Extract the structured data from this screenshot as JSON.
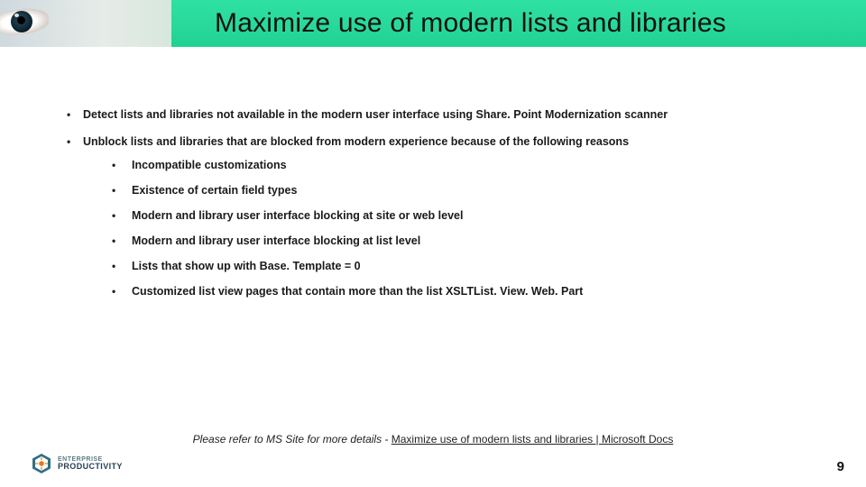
{
  "header": {
    "title": "Maximize use of modern lists and libraries"
  },
  "bullets": [
    {
      "text": "Detect lists and libraries not available in the modern user interface using  Share. Point Modernization scanner"
    },
    {
      "text": "Unblock lists and libraries that are blocked from modern experience because of the following reasons",
      "sub": [
        "Incompatible customizations",
        "Existence of certain field types",
        "Modern and library user interface blocking at site or web level",
        "Modern and library user interface blocking at list level",
        "Lists that show up with Base. Template = 0",
        "Customized list view pages that contain more than the list XSLTList. View. Web. Part"
      ]
    }
  ],
  "footer": {
    "prefix": "Please refer to MS Site for more details - ",
    "link_text": "Maximize use of modern lists and libraries | Microsoft Docs"
  },
  "logo": {
    "line1": "ENTERPRISE",
    "line2": "PRODUCTIVITY"
  },
  "page_number": "9"
}
